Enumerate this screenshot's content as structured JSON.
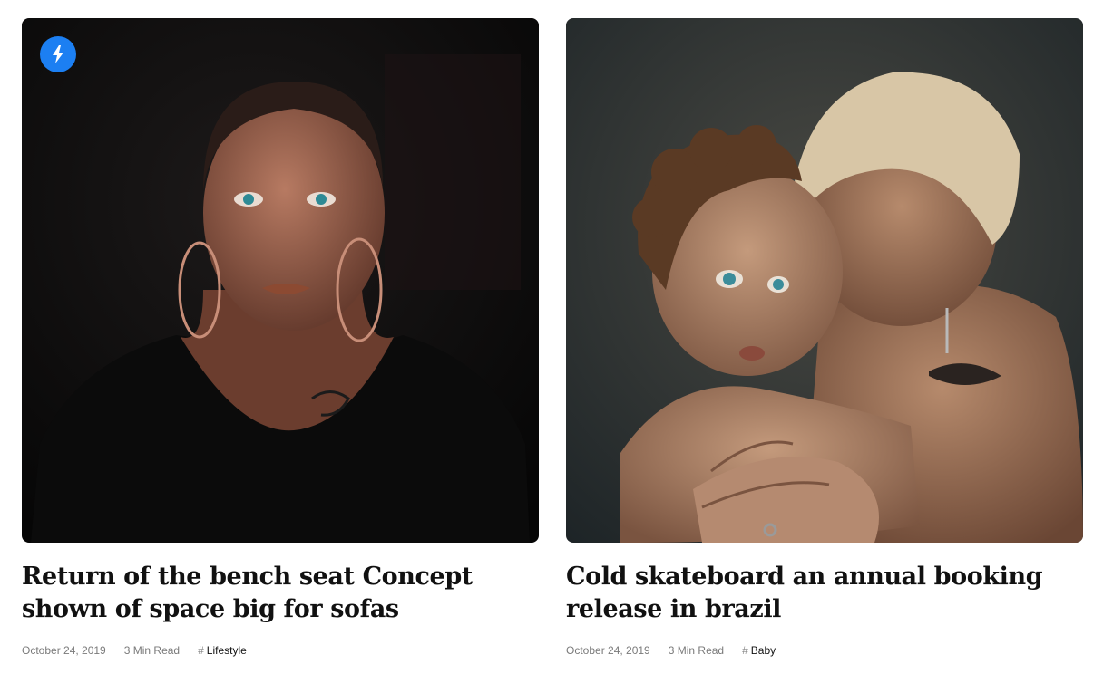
{
  "posts": [
    {
      "title": "Return of the bench seat Concept shown of space big for sofas",
      "date": "October 24, 2019",
      "read_time": "3 Min Read",
      "tag_hash": "#",
      "tag": "Lifestyle",
      "badge_icon": "lightning-icon",
      "image_subject": "woman-portrait-icon"
    },
    {
      "title": "Cold skateboard an annual booking release in brazil",
      "date": "October 24, 2019",
      "read_time": "3 Min Read",
      "tag_hash": "#",
      "tag": "Baby",
      "image_subject": "mother-child-portrait-icon"
    }
  ],
  "colors": {
    "badge": "#1c7ff2",
    "title": "#111111",
    "meta": "#7a7a7a"
  }
}
